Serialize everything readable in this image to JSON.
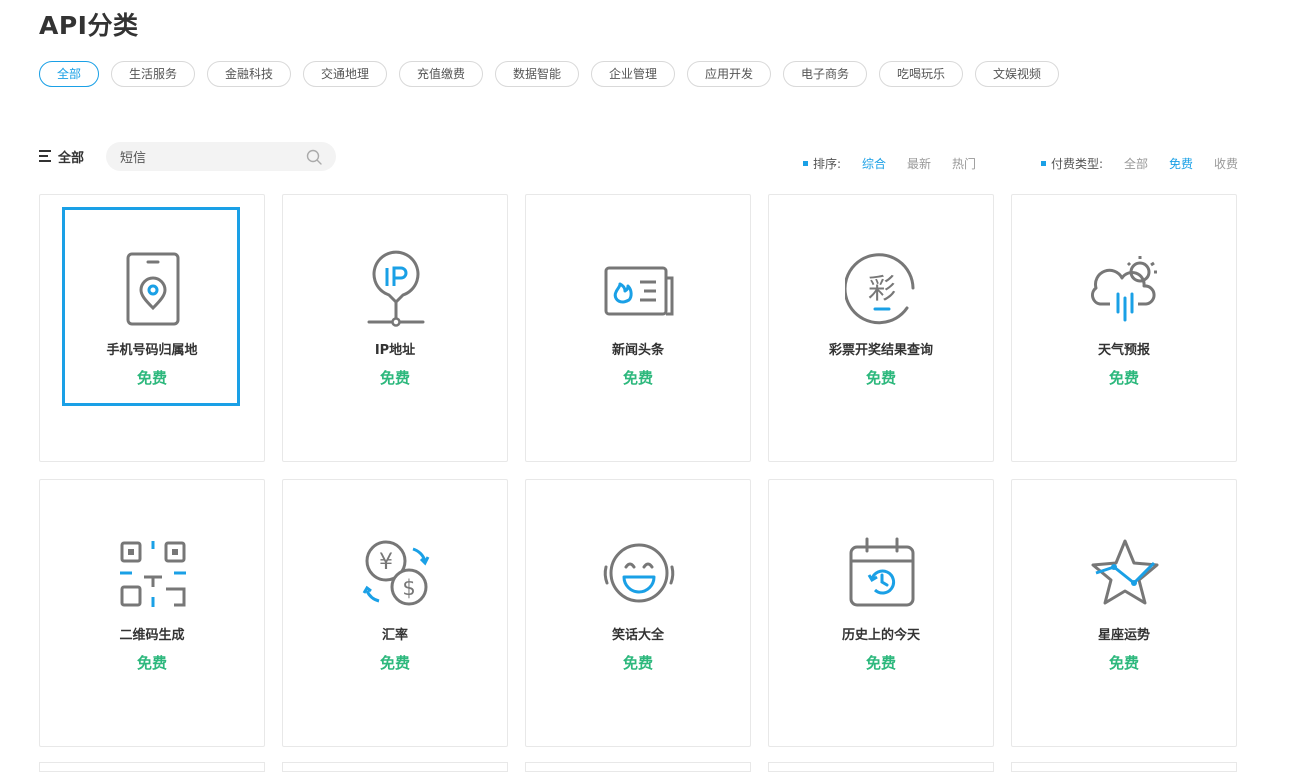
{
  "page": {
    "title": "API分类"
  },
  "categories": [
    "全部",
    "生活服务",
    "金融科技",
    "交通地理",
    "充值缴费",
    "数据智能",
    "企业管理",
    "应用开发",
    "电子商务",
    "吃喝玩乐",
    "文娱视频"
  ],
  "active_category": "全部",
  "toolbar": {
    "all_label": "全部",
    "search": {
      "value": "短信",
      "placeholder": ""
    }
  },
  "sort": {
    "label": "排序:",
    "options": [
      "综合",
      "最新",
      "热门"
    ],
    "active": "综合"
  },
  "payment": {
    "label": "付费类型:",
    "options": [
      "全部",
      "免费",
      "收费"
    ],
    "active": "免费"
  },
  "colors": {
    "accent": "#1aa0e6",
    "free": "#2db87d",
    "icon_gray": "#777777"
  },
  "cards": [
    {
      "name": "手机号码归属地",
      "price": "免费",
      "icon": "phone-location-icon",
      "selected": true
    },
    {
      "name": "IP地址",
      "price": "免费",
      "icon": "ip-pin-icon"
    },
    {
      "name": "新闻头条",
      "price": "免费",
      "icon": "newspaper-icon"
    },
    {
      "name": "彩票开奖结果查询",
      "price": "免费",
      "icon": "lottery-icon"
    },
    {
      "name": "天气预报",
      "price": "免费",
      "icon": "weather-icon"
    },
    {
      "name": "二维码生成",
      "price": "免费",
      "icon": "qr-code-icon"
    },
    {
      "name": "汇率",
      "price": "免费",
      "icon": "exchange-rate-icon"
    },
    {
      "name": "笑话大全",
      "price": "免费",
      "icon": "laughing-face-icon"
    },
    {
      "name": "历史上的今天",
      "price": "免费",
      "icon": "calendar-history-icon"
    },
    {
      "name": "星座运势",
      "price": "免费",
      "icon": "star-trend-icon"
    }
  ]
}
